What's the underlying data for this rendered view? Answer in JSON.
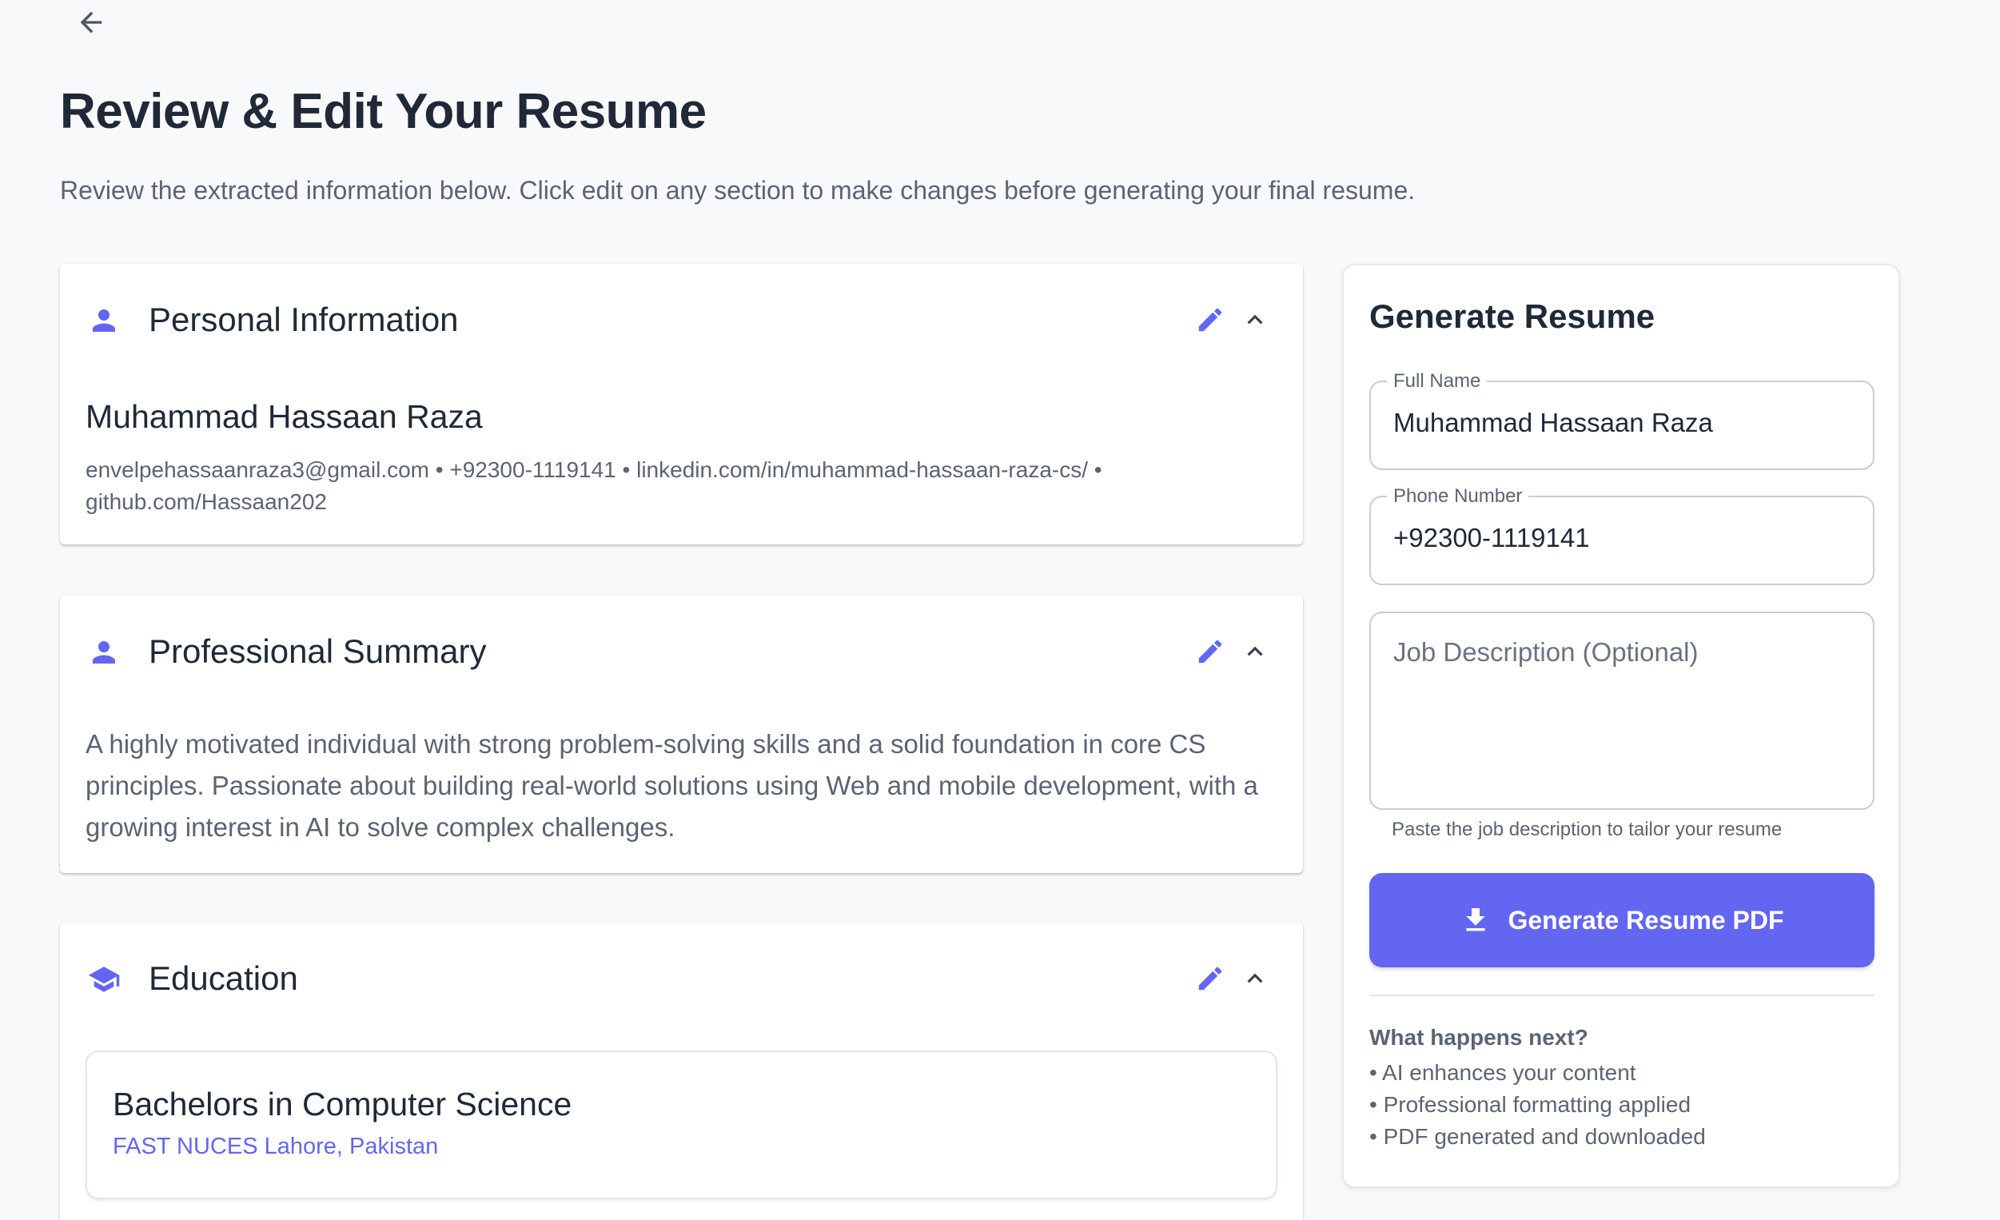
{
  "header": {
    "title": "Review & Edit Your Resume",
    "subtitle": "Review the extracted information below. Click edit on any section to make changes before generating your final resume."
  },
  "icons": {
    "back": "arrow-left-icon",
    "person": "person-icon",
    "school": "school-icon",
    "edit": "pencil-icon",
    "collapse": "chevron-up-icon",
    "download": "download-icon"
  },
  "colors": {
    "accent": "#6366f1",
    "background": "#f8f9fb",
    "text": "#1f2937",
    "muted": "#5b6472"
  },
  "sections": {
    "personal": {
      "title": "Personal Information",
      "name": "Muhammad Hassaan Raza",
      "contact": "envelpehassaanraza3@gmail.com • +92300-1119141 • linkedin.com/in/muhammad-hassaan-raza-cs/ • github.com/Hassaan202"
    },
    "summary": {
      "title": "Professional Summary",
      "text": "A highly motivated individual with strong problem-solving skills and a solid foundation in core CS principles. Passionate about building real-world solutions using Web and mobile development, with a growing interest in AI to solve complex challenges."
    },
    "education": {
      "title": "Education",
      "items": [
        {
          "degree": "Bachelors in Computer Science",
          "school": "FAST NUCES Lahore, Pakistan"
        }
      ]
    }
  },
  "generate": {
    "title": "Generate Resume",
    "full_name": {
      "label": "Full Name",
      "value": "Muhammad Hassaan Raza"
    },
    "phone": {
      "label": "Phone Number",
      "value": "+92300-1119141"
    },
    "job_description": {
      "placeholder": "Job Description (Optional)",
      "helper": "Paste the job description to tailor your resume"
    },
    "button_label": "Generate Resume PDF",
    "next": {
      "title": "What happens next?",
      "items": [
        "• AI enhances your content",
        "• Professional formatting applied",
        "• PDF generated and downloaded"
      ]
    }
  }
}
